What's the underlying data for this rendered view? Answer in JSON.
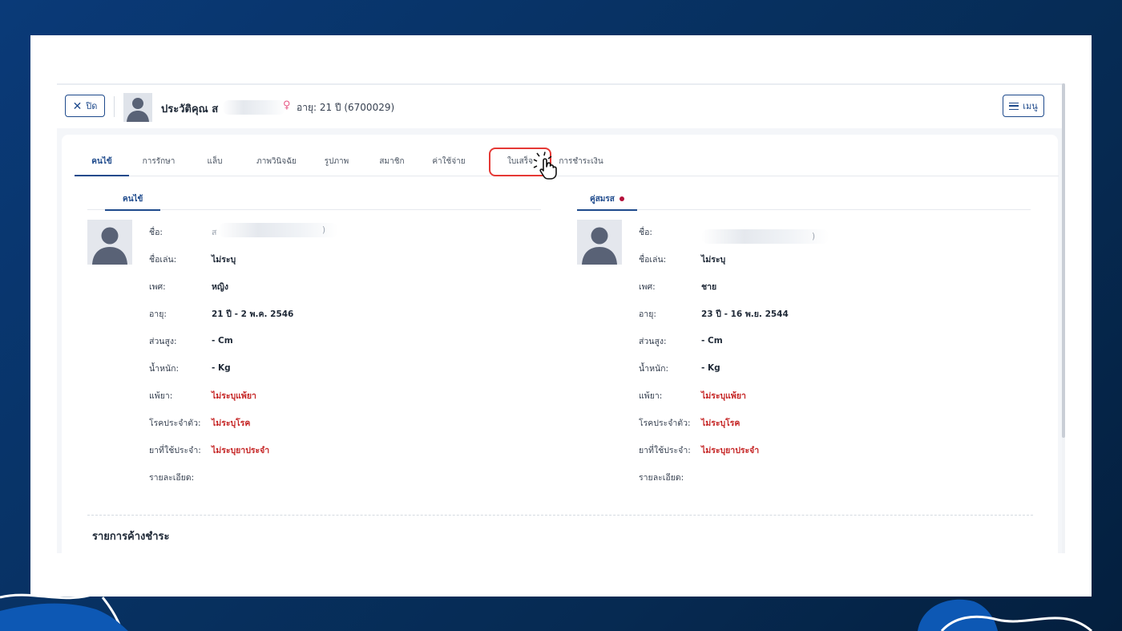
{
  "header": {
    "close_label": "ปิด",
    "title": "ประวัติคุณ ส",
    "age_text": "อายุ: 21 ปี (6700029)",
    "menu_label": "เมนู"
  },
  "tabs": [
    {
      "label": "คนไข้",
      "active": true
    },
    {
      "label": "การรักษา",
      "active": false
    },
    {
      "label": "แล็บ",
      "active": false
    },
    {
      "label": "ภาพวินิจฉัย",
      "active": false
    },
    {
      "label": "รูปภาพ",
      "active": false
    },
    {
      "label": "สมาชิก",
      "active": false
    },
    {
      "label": "ค่าใช้จ่าย",
      "active": false
    },
    {
      "label": "ใบเสร็จ",
      "active": false,
      "highlighted": true
    },
    {
      "label": "การชำระเงิน",
      "active": false
    }
  ],
  "patient": {
    "section_label": "คนไข้",
    "name_initial": "ส",
    "name_close": ")",
    "rows": [
      {
        "label": "ชื่อ:",
        "value": ""
      },
      {
        "label": "ชื่อเล่น:",
        "value": "ไม่ระบุ"
      },
      {
        "label": "เพศ:",
        "value": "หญิง"
      },
      {
        "label": "อายุ:",
        "value": "21 ปี - 2 พ.ค. 2546"
      },
      {
        "label": "ส่วนสูง:",
        "value": "- Cm"
      },
      {
        "label": "น้ำหนัก:",
        "value": "- Kg"
      },
      {
        "label": "แพ้ยา:",
        "value": "ไม่ระบุแพ้ยา"
      },
      {
        "label": "โรคประจำตัว:",
        "value": "ไม่ระบุโรค"
      },
      {
        "label": "ยาที่ใช้ประจำ:",
        "value": "ไม่ระบุยาประจำ"
      },
      {
        "label": "รายละเอียด:",
        "value": ""
      }
    ]
  },
  "spouse": {
    "section_label": "คู่สมรส",
    "name_close": ")",
    "rows": [
      {
        "label": "ชื่อ:",
        "value": ""
      },
      {
        "label": "ชื่อเล่น:",
        "value": "ไม่ระบุ"
      },
      {
        "label": "เพศ:",
        "value": "ชาย"
      },
      {
        "label": "อายุ:",
        "value": "23 ปี - 16 พ.ย. 2544"
      },
      {
        "label": "ส่วนสูง:",
        "value": "- Cm"
      },
      {
        "label": "น้ำหนัก:",
        "value": "- Kg"
      },
      {
        "label": "แพ้ยา:",
        "value": "ไม่ระบุแพ้ยา"
      },
      {
        "label": "โรคประจำตัว:",
        "value": "ไม่ระบุโรค"
      },
      {
        "label": "ยาที่ใช้ประจำ:",
        "value": "ไม่ระบุยาประจำ"
      },
      {
        "label": "รายละเอียด:",
        "value": ""
      }
    ]
  },
  "pending": {
    "title": "รายการค้างชำระ"
  },
  "colors": {
    "primary": "#1e4a8c",
    "highlight": "#e53935",
    "warning_text": "#c62828",
    "background": "#0a3a78"
  }
}
